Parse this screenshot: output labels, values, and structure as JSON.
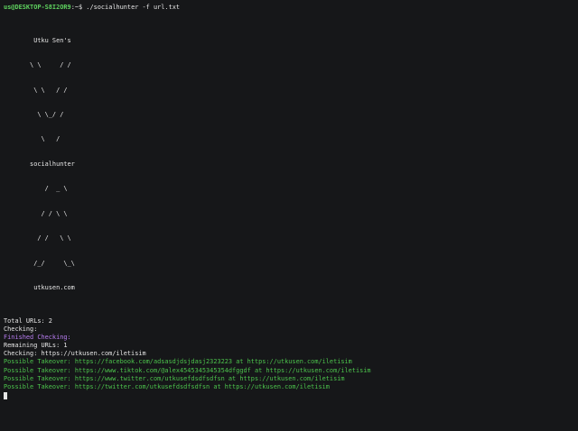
{
  "prompt": {
    "user_host": "us@DESKTOP-S8I2OR9",
    "path_symbol": ":~$",
    "command": "./socialhunter -f url.txt"
  },
  "banner": [
    "        Utku Sen's",
    "       \\ \\     / /",
    "        \\ \\   / /",
    "         \\ \\_/ /",
    "          \\   /",
    "       socialhunter",
    "           /  _ \\",
    "          / / \\ \\",
    "         / /   \\ \\",
    "        /_/     \\_\\",
    "        utkusen.com"
  ],
  "output": {
    "total_urls": "Total URLs: 2",
    "checking_1": "Checking:",
    "finished_checking": "Finished Checking:",
    "remaining_urls": "Remaining URLs: 1",
    "checking_2": "Checking: https://utkusen.com/iletisim",
    "takeovers": [
      "Possible Takeover: https://facebook.com/adsasdjdsjdasj2323223 at https://utkusen.com/iletisim",
      "Possible Takeover: https://www.tiktok.com/@alex4545345345354dfggdf at https://utkusen.com/iletisim",
      "Possible Takeover: https://www.twitter.com/utkusefdsdfsdfsn at https://utkusen.com/iletisim",
      "Possible Takeover: https://twitter.com/utkusefdsdfsdfsn at https://utkusen.com/iletisim"
    ]
  },
  "colors": {
    "background": "#161719",
    "foreground": "#e6e6e6",
    "prompt_green": "#5fd35f",
    "finished_purple": "#b77cf0",
    "takeover_green": "#4cc34c"
  }
}
